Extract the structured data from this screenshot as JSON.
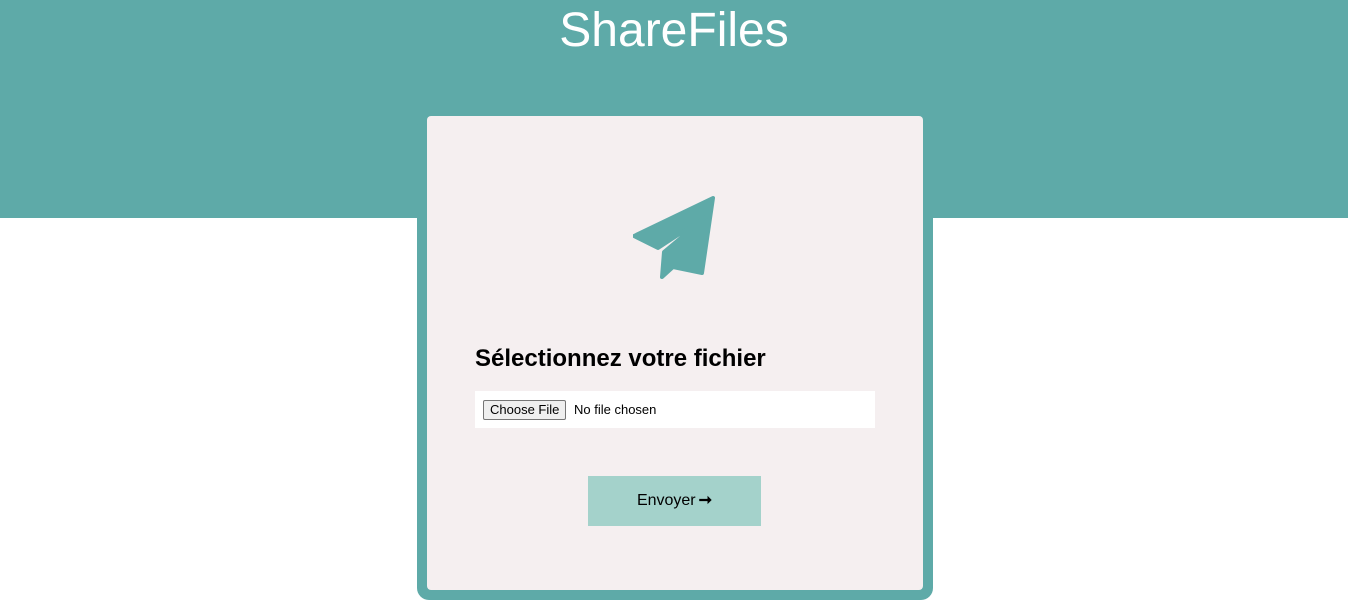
{
  "header": {
    "title": "ShareFiles",
    "background_color": "#5eaaa8"
  },
  "upload_card": {
    "icon": "paper-plane-icon",
    "title": "Sélectionnez votre fichier",
    "file_input": {
      "button_label": "Choose File",
      "status_text": "No file chosen"
    },
    "submit": {
      "label": "Envoyer",
      "icon": "arrow-right-icon",
      "icon_glyph": "➞",
      "background_color": "#a4d2cb"
    },
    "background_color": "#f5eff0",
    "border_color": "#5eaaa8"
  }
}
